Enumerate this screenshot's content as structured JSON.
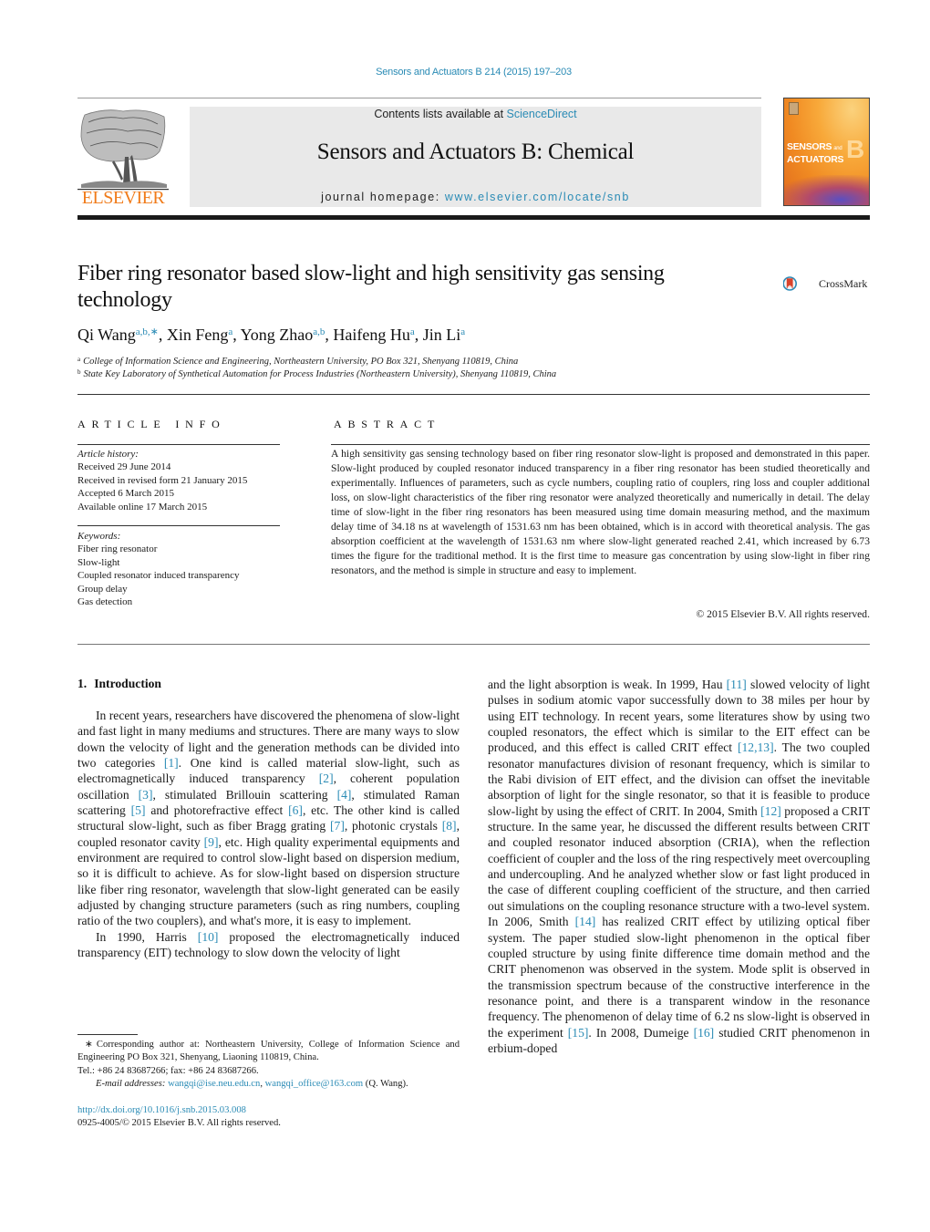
{
  "citation": "Sensors and Actuators B 214 (2015) 197–203",
  "header": {
    "contents_prefix": "Contents lists available at ",
    "contents_link": "ScienceDirect",
    "journal_name": "Sensors and Actuators B: Chemical",
    "homepage_prefix": "journal homepage: ",
    "homepage_link": "www.elsevier.com/locate/snb",
    "publisher_logo_text": "ELSEVIER",
    "cover_title_line1": "SENSORS",
    "cover_title_and": "and",
    "cover_title_line2": "ACTUATORS",
    "cover_letter": "B"
  },
  "article": {
    "title": "Fiber ring resonator based slow-light and high sensitivity gas sensing technology",
    "crossmark_label": "CrossMark",
    "authors": [
      {
        "name": "Qi Wang",
        "sup": "a,b,∗"
      },
      {
        "name": "Xin Feng",
        "sup": "a"
      },
      {
        "name": "Yong Zhao",
        "sup": "a,b"
      },
      {
        "name": "Haifeng Hu",
        "sup": "a"
      },
      {
        "name": "Jin Li",
        "sup": "a"
      }
    ],
    "affiliations": [
      {
        "mark": "a",
        "text": "College of Information Science and Engineering, Northeastern University, PO Box 321, Shenyang 110819, China"
      },
      {
        "mark": "b",
        "text": "State Key Laboratory of Synthetical Automation for Process Industries (Northeastern University), Shenyang 110819, China"
      }
    ]
  },
  "article_info": {
    "label": "ARTICLE INFO",
    "history_label": "Article history:",
    "history": [
      "Received 29 June 2014",
      "Received in revised form 21 January 2015",
      "Accepted 6 March 2015",
      "Available online 17 March 2015"
    ],
    "keywords_label": "Keywords:",
    "keywords": [
      "Fiber ring resonator",
      "Slow-light",
      "Coupled resonator induced transparency",
      "Group delay",
      "Gas detection"
    ]
  },
  "abstract": {
    "label": "ABSTRACT",
    "text": "A high sensitivity gas sensing technology based on fiber ring resonator slow-light is proposed and demonstrated in this paper. Slow-light produced by coupled resonator induced transparency in a fiber ring resonator has been studied theoretically and experimentally. Influences of parameters, such as cycle numbers, coupling ratio of couplers, ring loss and coupler additional loss, on slow-light characteristics of the fiber ring resonator were analyzed theoretically and numerically in detail. The delay time of slow-light in the fiber ring resonators has been measured using time domain measuring method, and the maximum delay time of 34.18 ns at wavelength of 1531.63 nm has been obtained, which is in accord with theoretical analysis. The gas absorption coefficient at the wavelength of 1531.63 nm where slow-light generated reached 2.41, which increased by 6.73 times the figure for the traditional method. It is the first time to measure gas concentration by using slow-light in fiber ring resonators, and the method is simple in structure and easy to implement.",
    "copyright": "© 2015 Elsevier B.V. All rights reserved."
  },
  "body": {
    "section_number": "1.",
    "section_title": "Introduction",
    "left_p1": [
      {
        "t": "In recent years, researchers have discovered the phenomena of slow-light and fast light in many mediums and structures. There are many ways to slow down the velocity of light and the generation methods can be divided into two categories "
      },
      {
        "ref": "[1]"
      },
      {
        "t": ". One kind is called material slow-light, such as electromagnetically induced transparency "
      },
      {
        "ref": "[2]"
      },
      {
        "t": ", coherent population oscillation "
      },
      {
        "ref": "[3]"
      },
      {
        "t": ", stimulated Brillouin scattering "
      },
      {
        "ref": "[4]"
      },
      {
        "t": ", stimulated Raman scattering "
      },
      {
        "ref": "[5]"
      },
      {
        "t": " and photorefractive effect "
      },
      {
        "ref": "[6]"
      },
      {
        "t": ", etc. The other kind is called structural slow-light, such as fiber Bragg grating "
      },
      {
        "ref": "[7]"
      },
      {
        "t": ", photonic crystals "
      },
      {
        "ref": "[8]"
      },
      {
        "t": ", coupled resonator cavity "
      },
      {
        "ref": "[9]"
      },
      {
        "t": ", etc. High quality experimental equipments and environment are required to control slow-light based on dispersion medium, so it is difficult to achieve. As for slow-light based on dispersion structure like fiber ring resonator, wavelength that slow-light generated can be easily adjusted by changing structure parameters (such as ring numbers, coupling ratio of the two couplers), and what's more, it is easy to implement."
      }
    ],
    "left_p2": [
      {
        "t": "In 1990, Harris "
      },
      {
        "ref": "[10]"
      },
      {
        "t": " proposed the electromagnetically induced transparency (EIT) technology to slow down the velocity of light"
      }
    ],
    "right_p1": [
      {
        "t": "and the light absorption is weak. In 1999, Hau "
      },
      {
        "ref": "[11]"
      },
      {
        "t": " slowed velocity of light pulses in sodium atomic vapor successfully down to 38 miles per hour by using EIT technology. In recent years, some literatures show by using two coupled resonators, the effect which is similar to the EIT effect can be produced, and this effect is called CRIT effect "
      },
      {
        "ref": "[12,13]"
      },
      {
        "t": ". The two coupled resonator manufactures division of resonant frequency, which is similar to the Rabi division of EIT effect, and the division can offset the inevitable absorption of light for the single resonator, so that it is feasible to produce slow-light by using the effect of CRIT. In 2004, Smith "
      },
      {
        "ref": "[12]"
      },
      {
        "t": " proposed a CRIT structure. In the same year, he discussed the different results between CRIT and coupled resonator induced absorption (CRIA), when the reflection coefficient of coupler and the loss of the ring respectively meet overcoupling and undercoupling. And he analyzed whether slow or fast light produced in the case of different coupling coefficient of the structure, and then carried out simulations on the coupling resonance structure with a two-level system. In 2006, Smith "
      },
      {
        "ref": "[14]"
      },
      {
        "t": " has realized CRIT effect by utilizing optical fiber system. The paper studied slow-light phenomenon in the optical fiber coupled structure by using finite difference time domain method and the CRIT phenomenon was observed in the system. Mode split is observed in the transmission spectrum because of the constructive interference in the resonance point, and there is a transparent window in the resonance frequency. The phenomenon of delay time of 6.2 ns slow-light is observed in the experiment "
      },
      {
        "ref": "[15]"
      },
      {
        "t": ". In 2008, Dumeige "
      },
      {
        "ref": "[16]"
      },
      {
        "t": " studied CRIT phenomenon in erbium-doped"
      }
    ]
  },
  "footnotes": {
    "star": "∗",
    "corresponding": "Corresponding author at: Northeastern University, College of Information Science and Engineering PO Box 321, Shenyang, Liaoning 110819, China.",
    "tel": "Tel.: +86 24 83687266; fax: +86 24 83687266.",
    "email_label": "E-mail addresses:",
    "emails": [
      "wangqi@ise.neu.edu.cn",
      "wangqi_office@163.com"
    ],
    "email_owner": "(Q. Wang).",
    "doi": "http://dx.doi.org/10.1016/j.snb.2015.03.008",
    "issn": "0925-4005/© 2015 Elsevier B.V. All rights reserved."
  },
  "colors": {
    "link": "#2a8bb5",
    "elsevier_orange": "#f07b1a",
    "header_box": "#e9e9e9"
  }
}
